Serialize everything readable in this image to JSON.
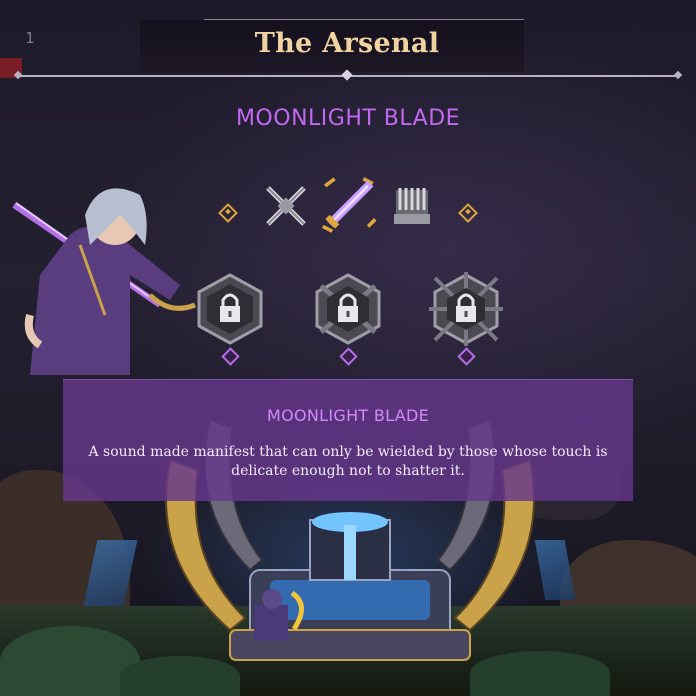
{
  "hud": {
    "level": "1"
  },
  "header": {
    "title": "The Arsenal"
  },
  "weapon": {
    "name": "MOONLIGHT BLADE",
    "selector": {
      "items": [
        {
          "icon": "crossed-swords-icon",
          "selected": false
        },
        {
          "icon": "moonlight-blade-icon",
          "selected": true
        },
        {
          "icon": "gauntlet-icon",
          "selected": false
        }
      ]
    }
  },
  "upgrades": {
    "slots": [
      {
        "icon": "lock-icon",
        "state": "locked"
      },
      {
        "icon": "lock-icon",
        "state": "locked"
      },
      {
        "icon": "lock-icon",
        "state": "locked"
      }
    ]
  },
  "description": {
    "title": "MOONLIGHT BLADE",
    "text": "A sound made manifest that can only be wielded by those whose touch is delicate enough not to shatter it."
  },
  "colors": {
    "title_gold": "#f1d3a1",
    "weapon_purple": "#c368f0",
    "panel_purple": "#67378c",
    "accent_gold": "#e0a63a"
  }
}
